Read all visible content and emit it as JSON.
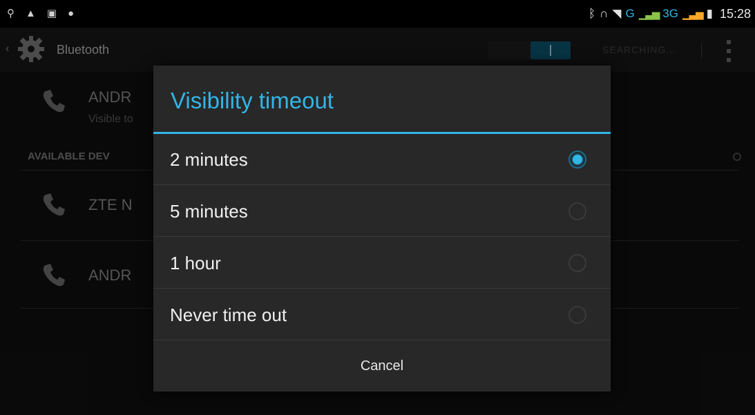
{
  "status_bar": {
    "left_icons": [
      "usb-icon",
      "lock-icon",
      "image-icon",
      "android-debug-icon"
    ],
    "right_icons": [
      "bluetooth-icon",
      "headset-icon",
      "wifi-icon"
    ],
    "network_g": "G",
    "network_3g": "3G",
    "time": "15:28"
  },
  "action_bar": {
    "title": "Bluetooth",
    "searching_label": "SEARCHING...",
    "toggle_state": "on"
  },
  "background": {
    "paired_device_name": "ANDR",
    "paired_device_sub": "Visible to",
    "section_header": "AVAILABLE DEV",
    "devices": [
      "ZTE N",
      "ANDR"
    ]
  },
  "dialog": {
    "title": "Visibility timeout",
    "options": [
      {
        "label": "2 minutes",
        "selected": true
      },
      {
        "label": "5 minutes",
        "selected": false
      },
      {
        "label": "1 hour",
        "selected": false
      },
      {
        "label": "Never time out",
        "selected": false
      }
    ],
    "cancel_label": "Cancel"
  },
  "colors": {
    "accent": "#33b5e5",
    "dialog_bg": "#282828",
    "background": "#121212"
  }
}
